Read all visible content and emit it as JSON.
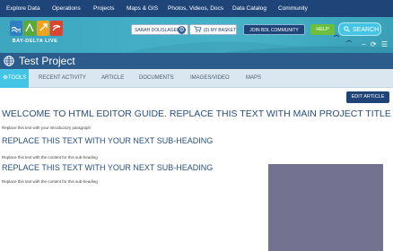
{
  "topnav": {
    "items": [
      "Explore Data",
      "Operations",
      "Projects",
      "Maps & GIS",
      "Photos, Videos, Docs",
      "Data Catalog",
      "Community"
    ]
  },
  "brand": {
    "logo_text": "BAY-DELTA LIVE",
    "tile_colors": [
      "#2f7fc2",
      "#5aaa3a",
      "#f0a21a",
      "#d9452e"
    ]
  },
  "header": {
    "user_label": "SARAH DOLISLAGER",
    "user_icon": "gear-icon",
    "basket_label": "(0) MY BASKET",
    "basket_icon": "cart-icon",
    "join_label": "JOIN BDL COMMUNITY",
    "help_label": "HELP",
    "search_label": "SEARCH",
    "mini_icons": [
      "minus-icon",
      "refresh-icon",
      "menu-icon"
    ]
  },
  "titlebar": {
    "title": "Test Project",
    "icon": "globe-icon"
  },
  "tabs": {
    "items": [
      "TOOLS",
      "RECENT ACTIVITY",
      "ARTICLE",
      "DOCUMENTS",
      "IMAGES/VIDEO",
      "MAPS"
    ],
    "active": "TOOLS"
  },
  "content": {
    "edit_button": "EDIT ARTICLE",
    "main_title": "WELCOME TO HTML EDITOR GUIDE. REPLACE THIS TEXT WITH MAIN PROJECT TITLE",
    "intro": "Replace this text with your introductory paragraph",
    "sections": [
      {
        "heading": "REPLACE THIS TEXT WITH YOUR NEXT SUB-HEADING",
        "body": "Replace this text with the content for this sub-heading"
      },
      {
        "heading": "REPLACE THIS TEXT WITH YOUR NEXT SUB-HEADING",
        "body": "Replace this text with the content for this sub-heading"
      }
    ]
  },
  "colors": {
    "nav_bg": "#1e4478",
    "banner_bg": "#46b3c9",
    "titlebar_bg": "#2c5c8c",
    "tabs_bg": "#dbe7f0",
    "accent": "#44c5e6",
    "help_green": "#6bbf3a",
    "heading_text": "#274f7f",
    "media_placeholder": "#737391"
  }
}
